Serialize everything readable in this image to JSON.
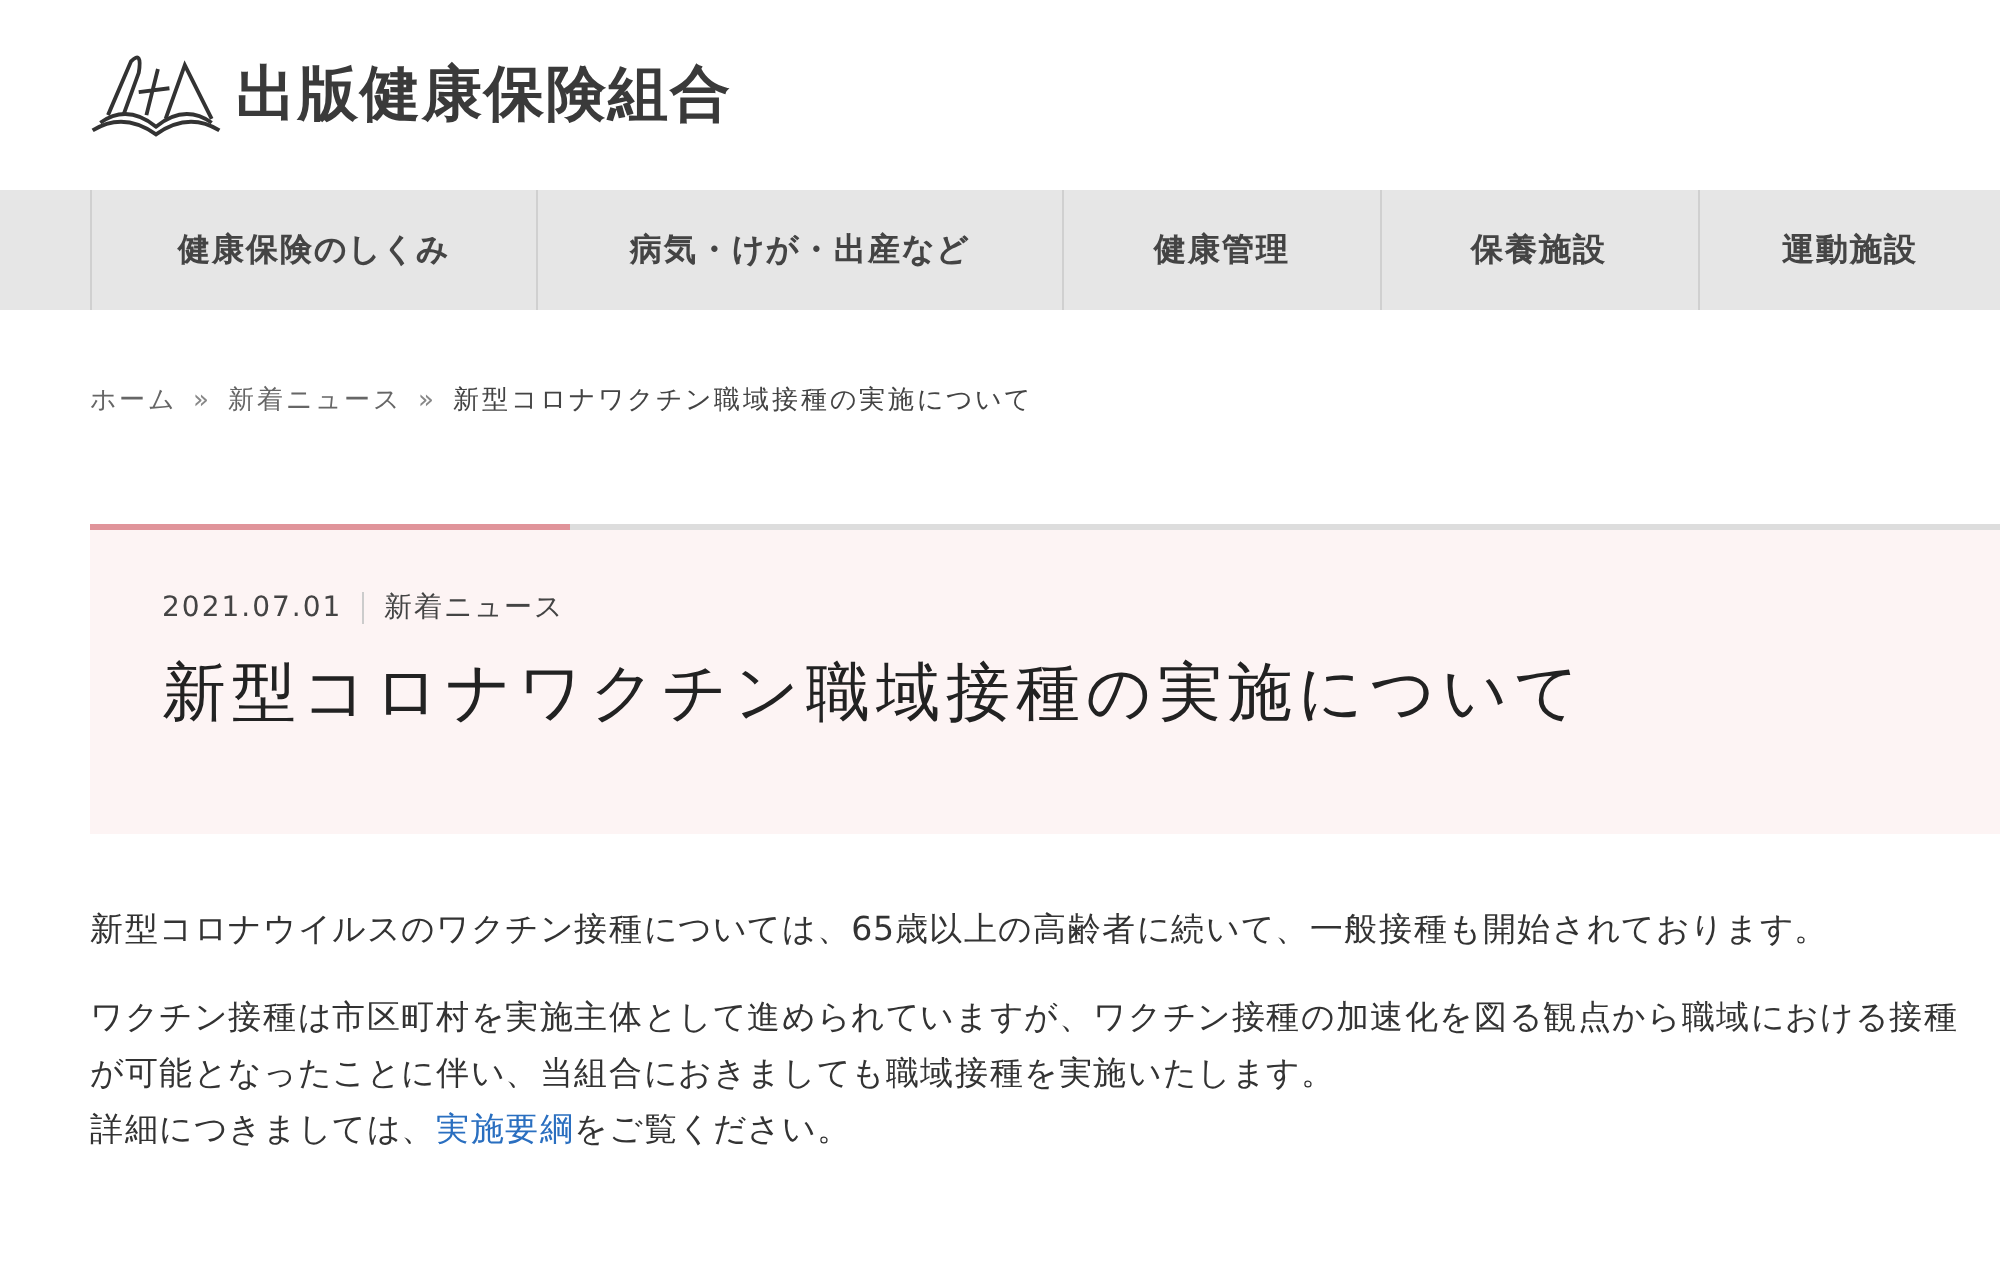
{
  "header": {
    "site_title": "出版健康保険組合"
  },
  "nav": [
    {
      "label": "健康保険のしくみ"
    },
    {
      "label": "病気・けが・出産など"
    },
    {
      "label": "健康管理"
    },
    {
      "label": "保養施設"
    },
    {
      "label": "運動施設"
    }
  ],
  "breadcrumb": [
    {
      "label": "ホーム",
      "kind": "link"
    },
    {
      "label": "»",
      "kind": "sep"
    },
    {
      "label": "新着ニュース",
      "kind": "link"
    },
    {
      "label": "»",
      "kind": "sep"
    },
    {
      "label": "新型コロナワクチン職域接種の実施について",
      "kind": "current"
    }
  ],
  "article": {
    "date": "2021.07.01",
    "category": "新着ニュース",
    "title": "新型コロナワクチン職域接種の実施について",
    "paragraphs": [
      {
        "lines": [
          {
            "text": "新型コロナウイルスのワクチン接種については、65歳以上の高齢者に続いて、一般接種も開始されております。"
          }
        ]
      },
      {
        "lines": [
          {
            "text": "ワクチン接種は市区町村を実施主体として進められていますが、ワクチン接種の加速化を図る観点から職域における接種が可能となったことに伴い、当組合におきましても職域接種を実施いたします。"
          },
          {
            "text": "詳細につきましては、",
            "link": "実施要綱",
            "text_after": "をご覧ください。"
          }
        ]
      }
    ]
  }
}
